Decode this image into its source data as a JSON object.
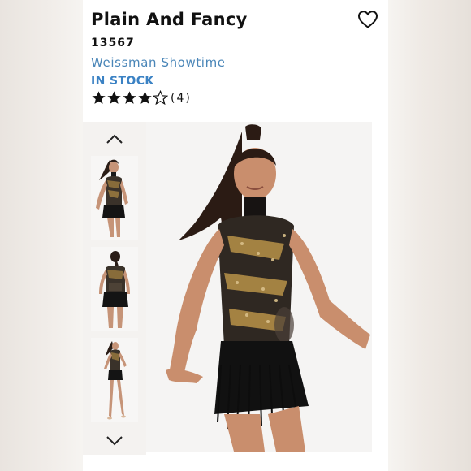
{
  "product": {
    "title": "Plain And Fancy",
    "sku": "13567",
    "brand": "Weissman Showtime",
    "stock": "IN STOCK",
    "rating": 4,
    "rating_max": 5,
    "review_count": "(4)"
  },
  "icons": {
    "favorite": "heart-outline-icon",
    "thumb_prev": "chevron-up-icon",
    "thumb_next": "chevron-down-icon",
    "star_filled": "star-filled-icon",
    "star_empty": "star-outline-icon"
  },
  "colors": {
    "brand_link": "#4a86b8",
    "stock": "#3b82c4",
    "text": "#111111"
  }
}
